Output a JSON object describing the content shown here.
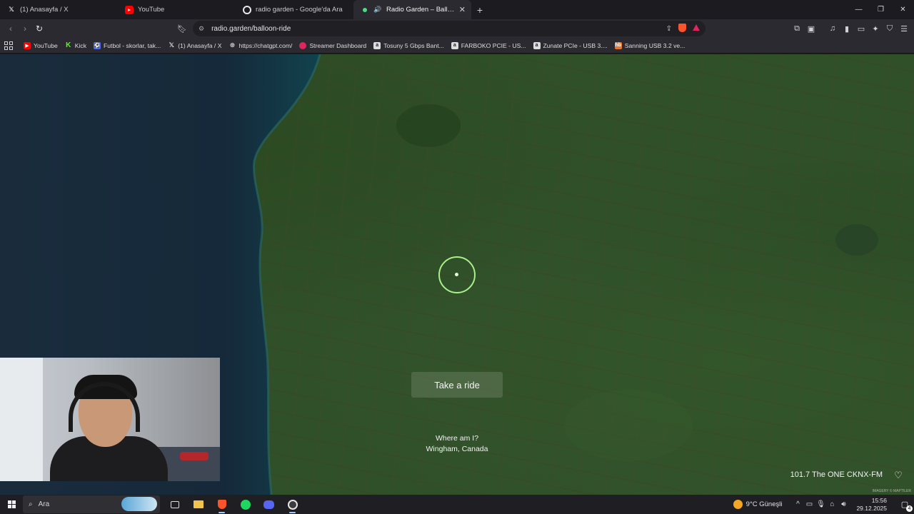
{
  "browser": {
    "tabs": [
      {
        "title": "(1) Anasayfa / X",
        "icon": "x-logo-icon",
        "active": false
      },
      {
        "title": "YouTube",
        "icon": "youtube-icon",
        "active": false
      },
      {
        "title": "radio garden - Google'da Ara",
        "icon": "google-icon",
        "active": false
      },
      {
        "title": "Radio Garden – Balloon Ride",
        "icon": "speaker-icon",
        "active": true
      }
    ],
    "new_tab_symbol": "+",
    "close_symbol": "✕",
    "url": "radio.garden/balloon-ride",
    "bookmarks": [
      {
        "label": "YouTube",
        "icon": "youtube-icon",
        "color": "#ff0000"
      },
      {
        "label": "Kick",
        "icon": "kick-icon",
        "color": "#53fc18"
      },
      {
        "label": "Futbol - skorlar, tak...",
        "icon": "futbol-icon",
        "color": "#4a6cf7"
      },
      {
        "label": "(1) Anasayfa / X",
        "icon": "x-logo-icon",
        "color": "#ffffff"
      },
      {
        "label": "https://chatgpt.com/",
        "icon": "chatgpt-icon",
        "color": "#dddddd"
      },
      {
        "label": "Streamer Dashboard",
        "icon": "streamer-icon",
        "color": "#e0245e"
      },
      {
        "label": "Tosuny 5 Gbps Bant...",
        "icon": "amazon-icon",
        "color": "#dddddd"
      },
      {
        "label": "FARBOKO PCIE - US...",
        "icon": "amazon-icon",
        "color": "#dddddd"
      },
      {
        "label": "Zunate PCIe - USB 3....",
        "icon": "amazon-icon",
        "color": "#dddddd"
      },
      {
        "label": "Sanning USB 3.2 ve...",
        "icon": "hb-icon",
        "color": "#e8762b"
      }
    ]
  },
  "page": {
    "ride_button": "Take a ride",
    "where_label": "Where am I?",
    "location": "Wingham, Canada",
    "station": "101.7 The ONE CKNX-FM",
    "attribution": "IMAGERY © MAPTILER",
    "colors": {
      "ring": "#a8f08a",
      "water": "#142a3e",
      "land": "#30502a"
    }
  },
  "taskbar": {
    "search_placeholder": "Ara",
    "weather": "9°C  Güneşli",
    "time": "15:56",
    "date": "29.12.2025",
    "notifications": "4"
  }
}
